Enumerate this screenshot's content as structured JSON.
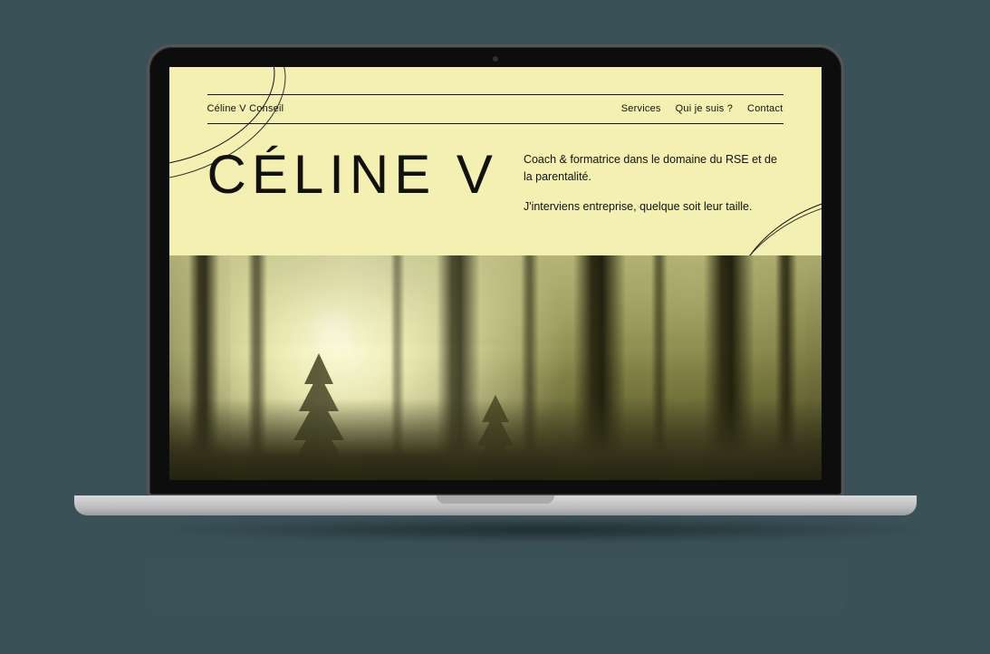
{
  "brand": "Céline V Conseil",
  "nav": {
    "services": "Services",
    "about": "Qui je suis ?",
    "contact": "Contact"
  },
  "hero": {
    "title": "CÉLINE V",
    "line1": "Coach & formatrice dans le domaine du RSE et de la parentalité.",
    "line2": "J'interviens entreprise, quelque soit leur taille."
  },
  "colors": {
    "page_bg": "#f3f0b1",
    "stage_bg": "#3a5158",
    "text": "#111111"
  }
}
